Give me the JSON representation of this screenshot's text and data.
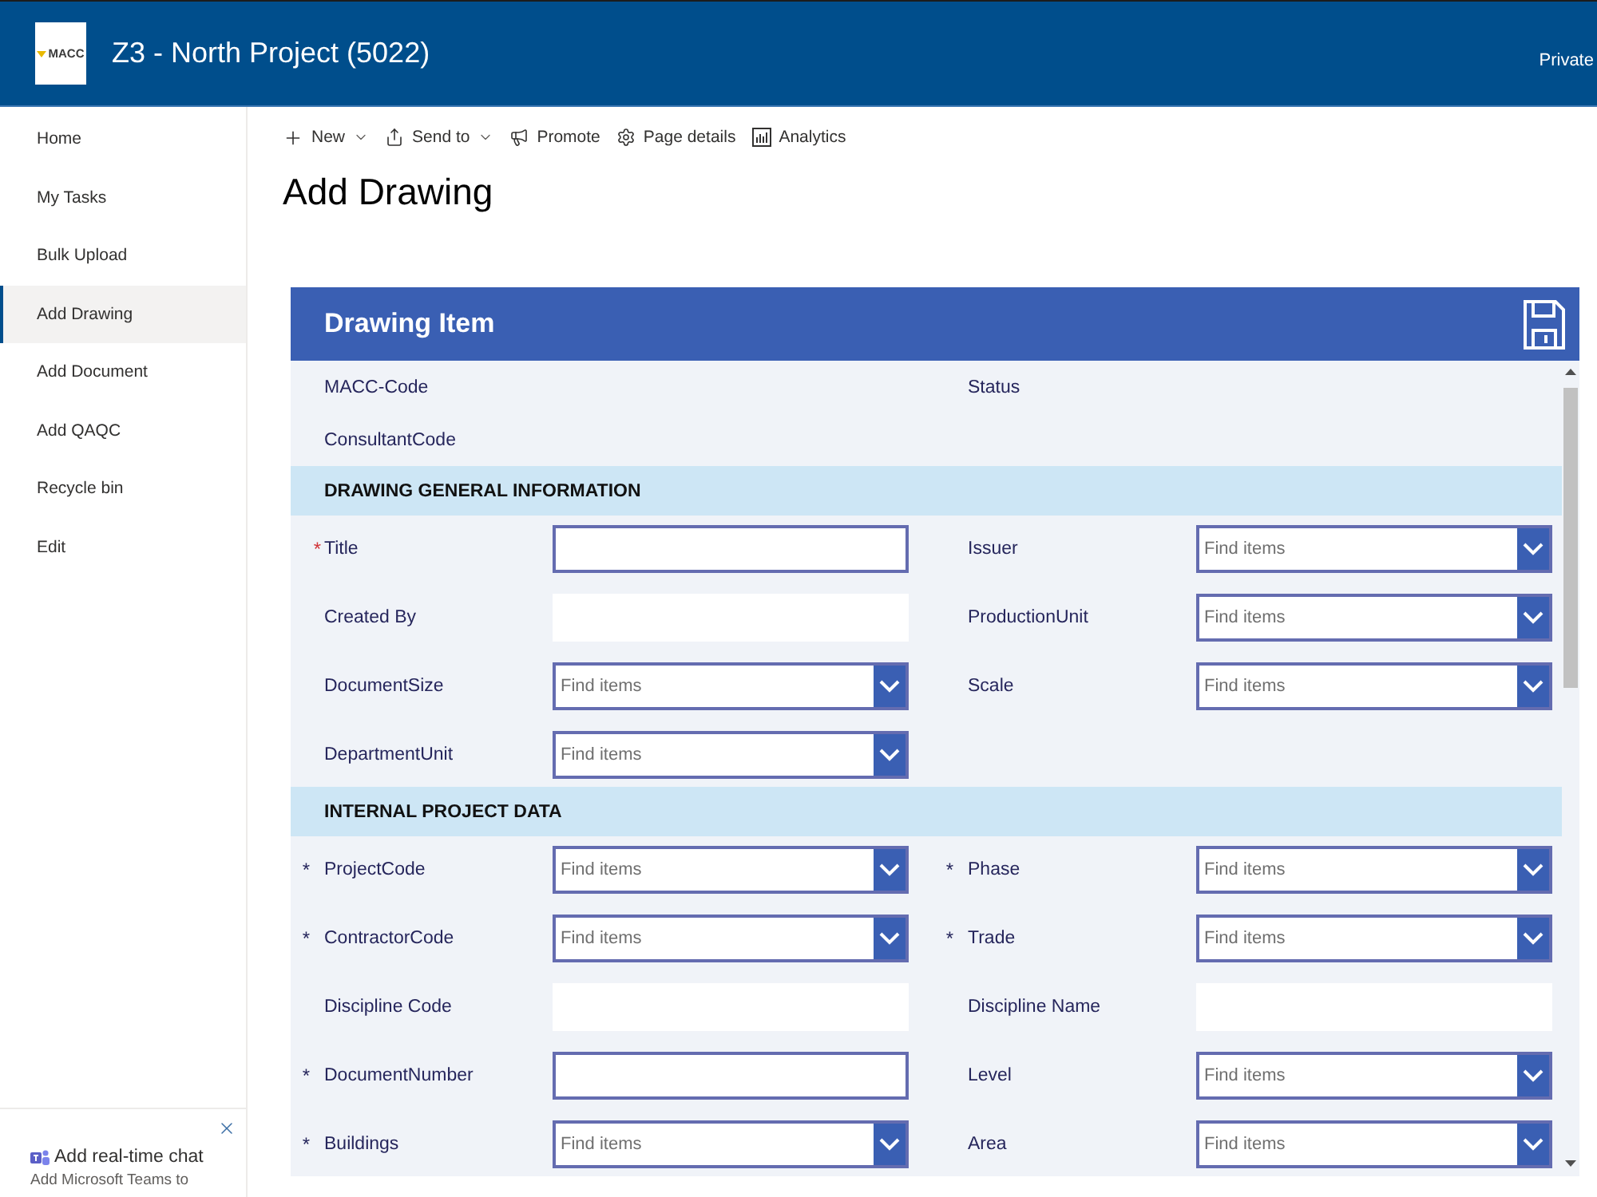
{
  "header": {
    "logo_text": "MACC",
    "title": "Z3 - North Project (5022)",
    "privacy": "Private"
  },
  "sidebar": {
    "items": [
      {
        "label": "Home",
        "selected": false
      },
      {
        "label": "My Tasks",
        "selected": false
      },
      {
        "label": "Bulk Upload",
        "selected": false
      },
      {
        "label": "Add Drawing",
        "selected": true
      },
      {
        "label": "Add Document",
        "selected": false
      },
      {
        "label": "Add QAQC",
        "selected": false
      },
      {
        "label": "Recycle bin",
        "selected": false
      },
      {
        "label": "Edit",
        "selected": false
      }
    ],
    "promo": {
      "title": "Add real-time chat",
      "text": "Add Microsoft Teams to"
    }
  },
  "command_bar": [
    {
      "kind": "new",
      "label": "New",
      "menu": true
    },
    {
      "kind": "send",
      "label": "Send to",
      "menu": true
    },
    {
      "kind": "promote",
      "label": "Promote",
      "menu": false
    },
    {
      "kind": "details",
      "label": "Page details",
      "menu": false
    },
    {
      "kind": "analytics",
      "label": "Analytics",
      "menu": false
    }
  ],
  "page_title": "Add Drawing",
  "form": {
    "title": "Drawing Item",
    "info_labels": [
      "MACC-Code",
      "Status",
      "ConsultantCode"
    ],
    "sections": [
      {
        "title": "DRAWING GENERAL INFORMATION",
        "fields": [
          {
            "label": "Title",
            "kind": "text",
            "marker": {
              "text": "*",
              "kind": "required"
            }
          },
          {
            "label": "Issuer",
            "kind": "lookup",
            "placeholder": "Find items"
          },
          {
            "label": "Created By",
            "kind": "readonly"
          },
          {
            "label": "ProductionUnit",
            "kind": "lookup",
            "placeholder": "Find items"
          },
          {
            "label": "DocumentSize",
            "kind": "lookup",
            "placeholder": "Find items"
          },
          {
            "label": "Scale",
            "kind": "lookup",
            "placeholder": "Find items"
          },
          {
            "label": "DepartmentUnit",
            "kind": "lookup",
            "placeholder": "Find items"
          }
        ]
      },
      {
        "title": "INTERNAL PROJECT DATA",
        "fields": [
          {
            "label": "ProjectCode",
            "kind": "lookup",
            "placeholder": "Find items",
            "marker": {
              "text": "*",
              "kind": "plain"
            }
          },
          {
            "label": "Phase",
            "kind": "lookup",
            "placeholder": "Find items",
            "marker": {
              "text": "*",
              "kind": "plain"
            }
          },
          {
            "label": "ContractorCode",
            "kind": "lookup",
            "placeholder": "Find items",
            "marker": {
              "text": "*",
              "kind": "plain"
            }
          },
          {
            "label": "Trade",
            "kind": "lookup",
            "placeholder": "Find items",
            "marker": {
              "text": "*",
              "kind": "plain"
            }
          },
          {
            "label": "Discipline Code",
            "kind": "readonly"
          },
          {
            "label": "Discipline Name",
            "kind": "readonly"
          },
          {
            "label": "DocumentNumber",
            "kind": "text",
            "marker": {
              "text": "*",
              "kind": "plain"
            }
          },
          {
            "label": "Level",
            "kind": "lookup",
            "placeholder": "Find items"
          },
          {
            "label": "Buildings",
            "kind": "lookup",
            "placeholder": "Find items",
            "marker": {
              "text": "*",
              "kind": "plain"
            }
          },
          {
            "label": "Area",
            "kind": "lookup",
            "placeholder": "Find items"
          }
        ]
      }
    ]
  }
}
